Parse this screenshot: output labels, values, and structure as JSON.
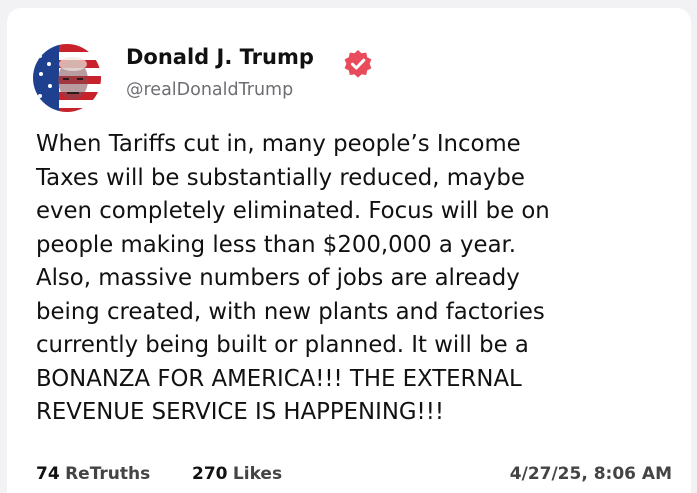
{
  "author": {
    "display_name": "Donald J. Trump",
    "handle": "@realDonaldTrump",
    "verified_color": "#e94a5c"
  },
  "post": {
    "lines": [
      "When Tariffs cut in, many people’s Income",
      "Taxes will be substantially reduced, maybe",
      "even completely eliminated. Focus will be on",
      "people making less than $200,000 a year.",
      "Also, massive numbers of jobs are already",
      "being created, with new plants and factories",
      "currently being built or planned. It will be a",
      "BONANZA FOR AMERICA!!! THE EXTERNAL",
      "REVENUE SERVICE IS HAPPENING!!!"
    ]
  },
  "stats": {
    "retruths_count": "74",
    "retruths_label": "ReTruths",
    "likes_count": "270",
    "likes_label": "Likes",
    "timestamp": "4/27/25, 8:06 AM"
  },
  "icons": {
    "verified": "verified-badge-icon",
    "avatar": "profile-avatar"
  }
}
